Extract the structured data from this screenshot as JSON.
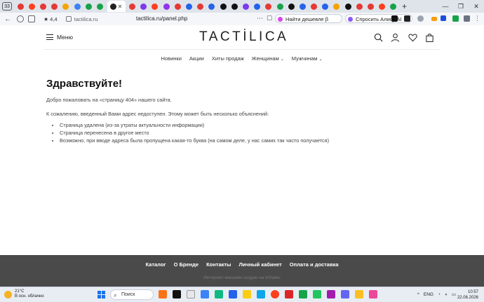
{
  "browser": {
    "tab_count": "33",
    "address": {
      "rating_value": "4,4",
      "domain": "tactilica.ru",
      "url": "tactilica.ru/panel.php"
    },
    "pills": {
      "find_cheaper": "Найти дешевле",
      "find_cheaper_suffix": "β",
      "ask_alice": "Спросить Алису AI"
    }
  },
  "site": {
    "menu_label": "Меню",
    "logo": "TACTİLICA",
    "nav": {
      "items": [
        "Новинки",
        "Акции",
        "Хиты продаж",
        "Женщинам",
        "Мужчинам"
      ]
    },
    "content": {
      "title": "Здравствуйте!",
      "intro": "Добро пожаловать на «страницу 404» нашего сайта.",
      "explain": "К сожалению, введенный Вами адрес недоступен. Этому может быть несколько объяснений:",
      "reasons": [
        "Страница удалена (из-за утраты актуальности информации)",
        "Страница перенесена в другое место",
        "Возможно, при вводе адреса была пропущена какая-то буква (на самом деле, у нас самих так часто получается)"
      ]
    },
    "footer": {
      "links": [
        "Каталог",
        "О Бренде",
        "Контакты",
        "Личный кабинет",
        "Оплата и доставка"
      ],
      "note": "Интернет-магазин создан на InSales"
    }
  },
  "taskbar": {
    "weather_temp": "21°C",
    "weather_desc": "В осн. облачно",
    "search_placeholder": "Поиск",
    "lang": "ENG",
    "time": "10:57",
    "date": "22.06.2026"
  },
  "colors": {
    "footer_bg": "#4a4a4a",
    "text_dark": "#222222",
    "yandex_red": "#fc3f1d"
  }
}
